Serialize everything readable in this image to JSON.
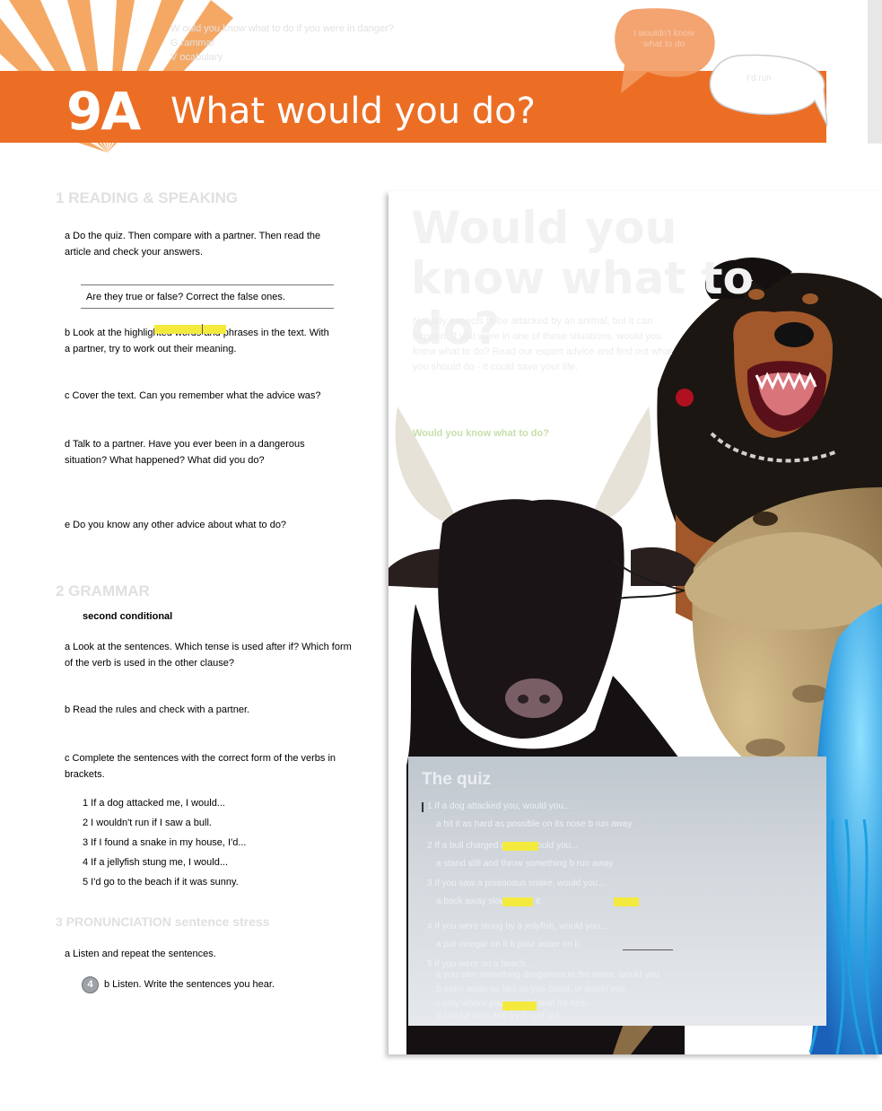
{
  "header": {
    "unit_number": "9A",
    "unit_title": "What would you do?",
    "top_lines": [
      "W ould you know what to do if you were in danger?",
      "G rammar",
      "V ocabulary"
    ],
    "bubble_1": "I wouldn't know what to do",
    "bubble_2": "I'd run"
  },
  "colors": {
    "banner": "#ec6e25",
    "highlight": "#f4ea3e",
    "quiz_panel": "#cfd5da",
    "article_question": "#c6dfaa"
  },
  "left_column": {
    "items": [
      "1 READING & SPEAKING",
      "a Do the quiz. Then compare with a partner. Then read the article and check your answers.",
      "Are they true or false? Correct the false ones.",
      "b Look at the highlighted words and phrases in the text. With a partner, try to work out their meaning.",
      "c Cover the text. Can you remember what the advice was?",
      "d Talk to a partner. Have you ever been in a dangerous situation? What happened? What did you do?",
      "e Do you know any other advice about what to do?",
      "2 GRAMMAR",
      "second conditional",
      "a Look at the sentences. Which tense is used after if? Which form of the verb is used in the other clause?",
      "b Read the rules and check with a partner.",
      "c Complete the sentences with the correct form of the verbs in brackets.",
      "1 If a dog attacked me, I would...",
      "2 I wouldn't run if I saw a bull.",
      "3 If I found a snake in my house, I'd...",
      "4 If a jellyfish stung me, I would...",
      "5 I'd go to the beach if it was sunny.",
      "3 PRONUNCIATION sentence stress",
      "a Listen and repeat the sentences.",
      "b Listen. Write the sentences you hear."
    ]
  },
  "page_number": "4",
  "article": {
    "title": "Would you know what to do?",
    "intro": "Nobody expects to be attacked by an animal, but it can happen. If you were in one of these situations, would you know what to do? Read our expert advice and find out what you should do - it could save your life.",
    "question": "Would you know what to do?"
  },
  "quiz": {
    "title": "The quiz",
    "lines": [
      "1 If a dog attacked you, would you...",
      "a hit it as hard as possible on its nose                       b run away",
      "2 If a bull charged at you, would you...",
      "a stand still and throw something      b run away",
      "3 If you saw a poisonous snake, would you...",
      "a back away slowly                          b kill it",
      "4 If you were stung by a jellyfish, would you...",
      "a put vinegar on it          b pour water on it",
      "5 If you were on a beach...",
      "a you saw something dangerous in the water, would you",
      "b swim away as fast as you could, or would you",
      "c stay where you are and wait for help",
      "d call for help and try to get out"
    ]
  }
}
